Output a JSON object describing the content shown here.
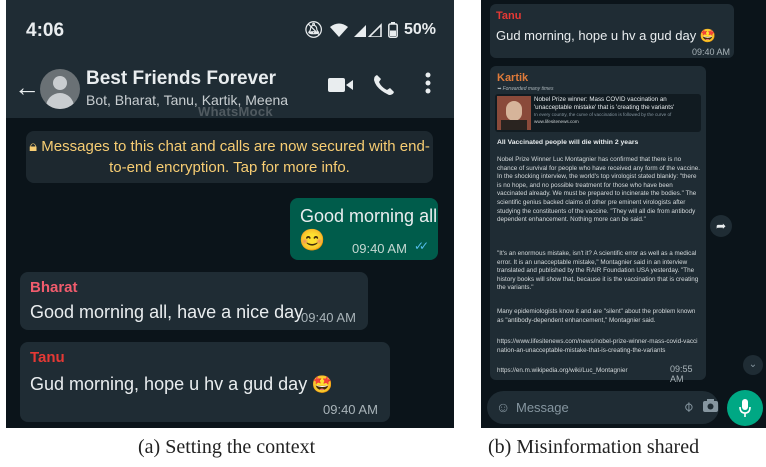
{
  "panel_a": {
    "status_bar": {
      "time": "4:06",
      "battery": "50%"
    },
    "header": {
      "title": "Best Friends Forever",
      "members": "Bot, Bharat, Tanu, Kartik, Meena",
      "watermark": "WhatsMock"
    },
    "encryption_notice": "Messages to this chat and calls are now secured with end-to-end encryption. Tap for more info.",
    "messages": [
      {
        "type": "outgoing",
        "text": "Good morning all",
        "emoji": "😊",
        "time": "09:40 AM",
        "ticks": "✓✓"
      },
      {
        "type": "incoming",
        "sender": "Bharat",
        "sender_color": "#f15c6d",
        "text": "Good morning all, have a nice day",
        "time": "09:40 AM"
      },
      {
        "type": "incoming",
        "sender": "Tanu",
        "sender_color": "#e53935",
        "text": "Gud morning, hope u hv a gud day",
        "emoji": "🤩",
        "time": "09:40 AM"
      }
    ],
    "caption": "(a) Setting the context"
  },
  "panel_b": {
    "tanu_message": {
      "sender": "Tanu",
      "text": "Gud morning, hope u hv a gud day",
      "emoji": "🤩",
      "time": "09:40 AM"
    },
    "forwarded_message": {
      "sender": "Kartik",
      "forwarded_label": "Forwarded many times",
      "preview_title": "Nobel Prize winner: Mass COVID vaccination an 'unacceptable mistake' that is 'creating the variants'",
      "preview_desc": "In every country, the curve of vaccination is followed by the curve of",
      "preview_site": "www.lifesitenews.com",
      "headline": "All Vaccinated people will die within 2 years",
      "paragraphs": [
        "Nobel Prize Winner Luc Montagnier has confirmed that there is no chance of survival for people who have received any form of the vaccine. In the shocking interview, the world's top virologist stated blankly: \"there is no hope, and no possible treatment for those who have been vaccinated already. We must be prepared to incinerate the bodies.\" The scientific genius backed claims of other pre eminent virologists after studying the constituents of the vaccine. \"They will all die from antibody dependent enhancement. Nothing more can be said.\"",
        "\"It's an enormous mistake, isn't it? A scientific error as well as a medical error. It is an unacceptable mistake,\" Montagnier said in an interview translated and published by the RAIR Foundation USA yesterday. \"The history books will show that, because it is the vaccination that is creating the variants.\"",
        "Many epidemiologists know it and are \"silent\" about the problem known as \"antibody-dependent enhancement,\" Montagnier said."
      ],
      "link1": "https://www.lifesitenews.com/news/nobel-prize-winner-mass-covid-vaccination-an-unacceptable-mistake-that-is-creating-the-variants",
      "link2": "https://en.m.wikipedia.org/wiki/Luc_Montagnier",
      "time": "09:55 AM"
    },
    "composer": {
      "placeholder": "Message"
    },
    "caption": "(b) Misinformation shared"
  }
}
